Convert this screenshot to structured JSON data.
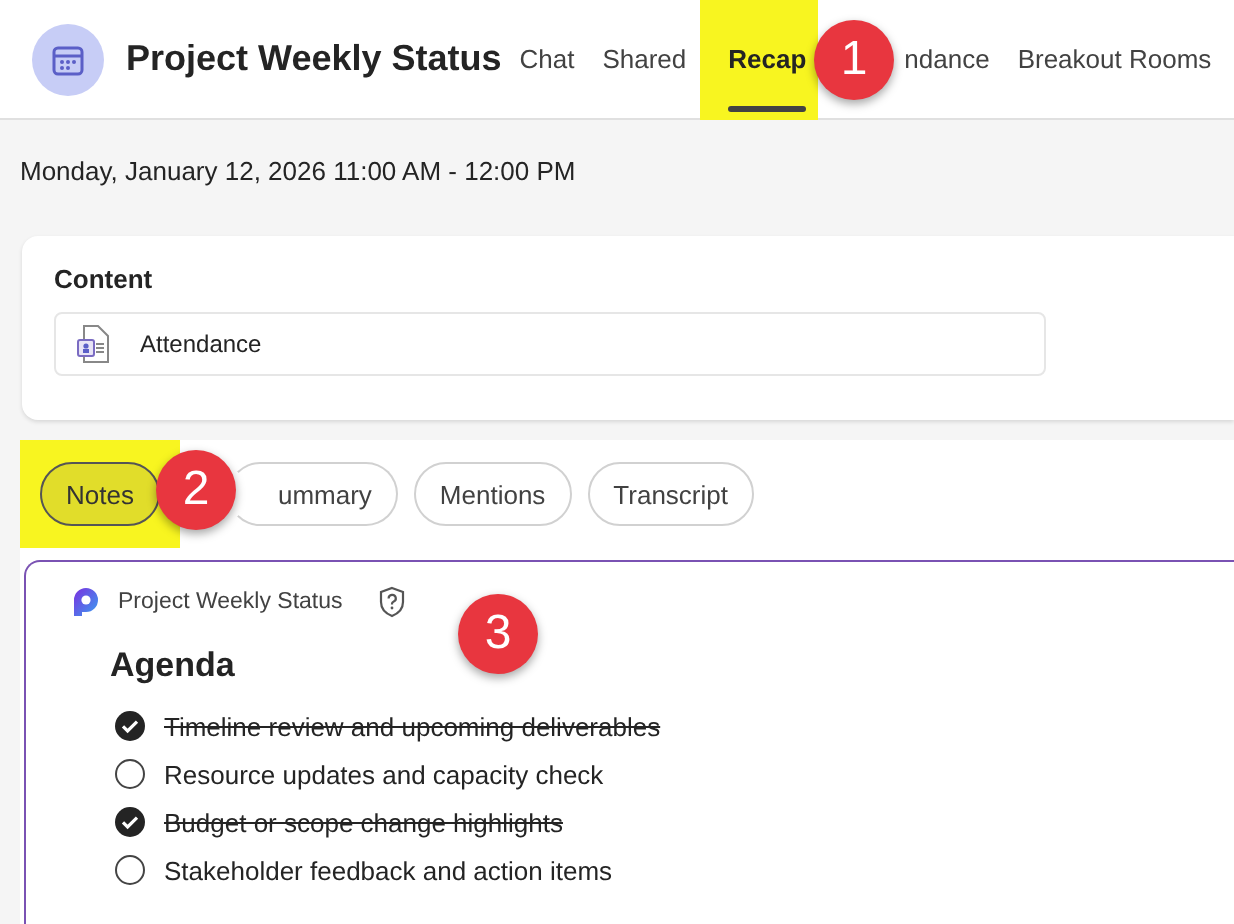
{
  "meeting": {
    "title": "Project Weekly Status"
  },
  "tabs": [
    {
      "label": "Chat",
      "selected": false,
      "highlighted": false
    },
    {
      "label": "Shared",
      "selected": false,
      "highlighted": false
    },
    {
      "label": "Recap",
      "selected": true,
      "highlighted": true
    },
    {
      "label": "ndance",
      "selected": false,
      "highlighted": false
    },
    {
      "label": "Breakout Rooms",
      "selected": false,
      "highlighted": false
    }
  ],
  "date_range": "Monday, January 12, 2026 11:00 AM - 12:00 PM",
  "content": {
    "heading": "Content",
    "items": [
      {
        "label": "Attendance"
      }
    ]
  },
  "pills": [
    {
      "label": "Notes",
      "selected": true,
      "highlighted": true
    },
    {
      "label": "ummary",
      "selected": false,
      "highlighted": false
    },
    {
      "label": "Mentions",
      "selected": false,
      "highlighted": false
    },
    {
      "label": "Transcript",
      "selected": false,
      "highlighted": false
    }
  ],
  "notes": {
    "source": "Project Weekly Status",
    "heading": "Agenda",
    "items": [
      {
        "text": "Timeline review and upcoming deliverables",
        "checked": true
      },
      {
        "text": "Resource updates and capacity check",
        "checked": false
      },
      {
        "text": "Budget or scope change highlights",
        "checked": true
      },
      {
        "text": "Stakeholder feedback and action items",
        "checked": false
      }
    ]
  },
  "callouts": [
    {
      "number": "1"
    },
    {
      "number": "2"
    },
    {
      "number": "3"
    }
  ]
}
